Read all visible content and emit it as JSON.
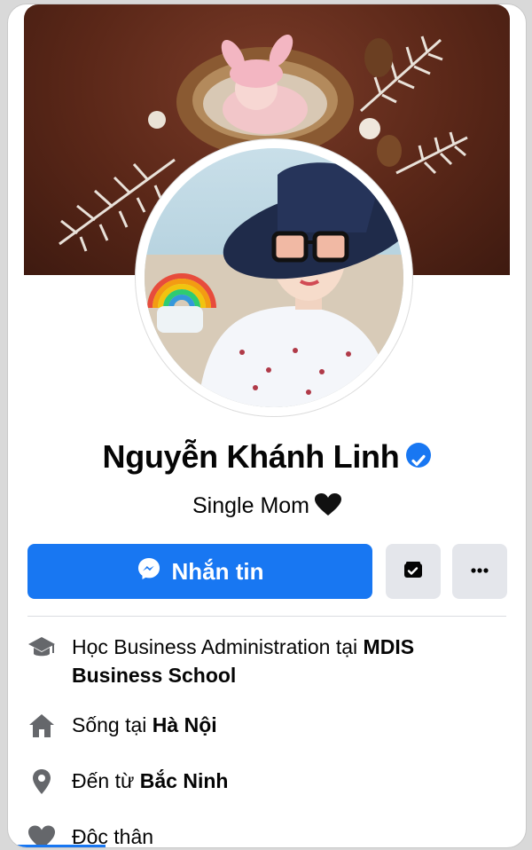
{
  "profile": {
    "name": "Nguyễn Khánh Linh",
    "bio": "Single Mom",
    "verified": true
  },
  "actions": {
    "message_label": "Nhắn tin"
  },
  "info": {
    "education_prefix": "Học Business Administration tại ",
    "education_school": "MDIS Business School",
    "lives_prefix": "Sống tại ",
    "lives_city": "Hà Nội",
    "from_prefix": "Đến từ ",
    "from_city": "Bắc Ninh",
    "relationship": "Độc thân"
  },
  "icons": {
    "verified": "verified-badge-icon",
    "bio_emoji": "black-heart-icon",
    "message": "messenger-icon",
    "wallet": "wallet-icon",
    "more": "more-dots-icon",
    "education": "graduation-cap-icon",
    "lives": "home-icon",
    "from": "location-pin-icon",
    "relationship": "heart-icon"
  },
  "colors": {
    "accent": "#1877f2",
    "secondary_button": "#e4e6eb",
    "icon_gray": "#65676b",
    "text": "#050505"
  }
}
